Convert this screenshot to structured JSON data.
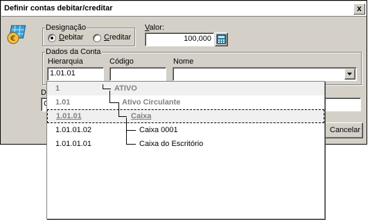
{
  "window": {
    "title": "Definir contas debitar/creditar",
    "close": "x"
  },
  "designacao": {
    "label": "Designação",
    "options": [
      {
        "label": "Debitar",
        "selected": true
      },
      {
        "label": "Creditar",
        "selected": false
      }
    ]
  },
  "valor": {
    "label": "Valor:",
    "value": "100,000"
  },
  "dados_conta": {
    "label": "Dados da Conta",
    "hierarquia": {
      "label": "Hierarquia",
      "value": "1.01.01"
    },
    "codigo": {
      "label": "Código",
      "value": ""
    },
    "nome": {
      "label": "Nome",
      "value": ""
    }
  },
  "hidden_label_partial": "De",
  "hidden_field_partial": "C",
  "cancel_button": {
    "label": "Cancelar"
  },
  "tree": [
    {
      "code": "1",
      "name": "ATIVO",
      "style": "grey-bold"
    },
    {
      "code": "1.01",
      "name": "Ativo Circulante",
      "style": "grey-bold"
    },
    {
      "code": "1.01.01",
      "name": "Caixa",
      "style": "grey-bold-underline"
    },
    {
      "code": "1.01.01.02",
      "name": "Caixa 0001",
      "style": "normal"
    },
    {
      "code": "1.01.01.01",
      "name": "Caixa do Escritório",
      "style": "normal"
    }
  ],
  "colors": {
    "dialog_bg": "#d4d0c8",
    "grey_text": "#808080",
    "window_border": "#000000"
  }
}
